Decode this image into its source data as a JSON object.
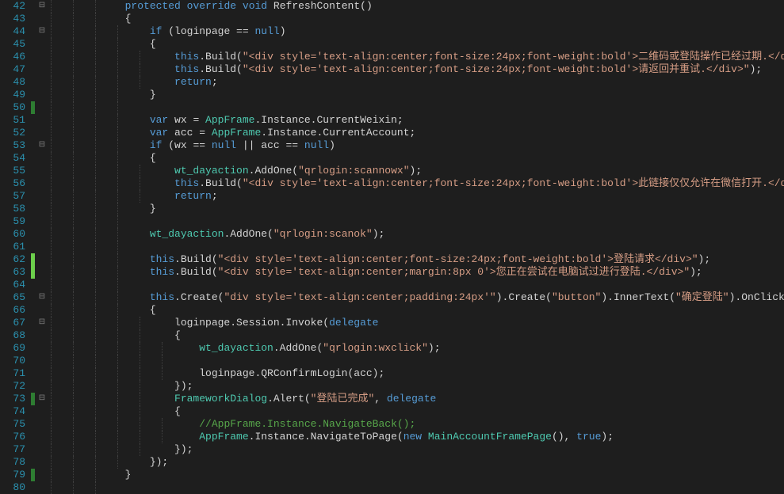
{
  "startLine": 42,
  "lines": [
    {
      "ln": 42,
      "fold": "⊟",
      "mark": "",
      "guides": 3,
      "html": "            <span class='kw'>protected</span> <span class='kw'>override</span> <span class='kw'>void</span> <span class='txt'>RefreshContent()</span>"
    },
    {
      "ln": 43,
      "fold": "",
      "mark": "",
      "guides": 3,
      "html": "            {"
    },
    {
      "ln": 44,
      "fold": "⊟",
      "mark": "",
      "guides": 4,
      "html": "                <span class='kw'>if</span> (loginpage == <span class='kw'>null</span>)"
    },
    {
      "ln": 45,
      "fold": "",
      "mark": "",
      "guides": 4,
      "html": "                {"
    },
    {
      "ln": 46,
      "fold": "",
      "mark": "",
      "guides": 5,
      "html": "                    <span class='kw'>this</span>.Build(<span class='str'>\"&lt;div style='text-align:center;font-size:24px;font-weight:bold'&gt;二维码或登陆操作已经过期.&lt;/div&gt;\"</span>);"
    },
    {
      "ln": 47,
      "fold": "",
      "mark": "",
      "guides": 5,
      "html": "                    <span class='kw'>this</span>.Build(<span class='str'>\"&lt;div style='text-align:center;font-size:24px;font-weight:bold'&gt;请返回并重试.&lt;/div&gt;\"</span>);"
    },
    {
      "ln": 48,
      "fold": "",
      "mark": "",
      "guides": 5,
      "html": "                    <span class='kw'>return</span>;"
    },
    {
      "ln": 49,
      "fold": "",
      "mark": "",
      "guides": 4,
      "html": "                }"
    },
    {
      "ln": 50,
      "fold": "",
      "mark": "green",
      "guides": 4,
      "html": ""
    },
    {
      "ln": 51,
      "fold": "",
      "mark": "",
      "guides": 4,
      "html": "                <span class='kw'>var</span> wx = <span class='type'>AppFrame</span>.Instance.CurrentWeixin;"
    },
    {
      "ln": 52,
      "fold": "",
      "mark": "",
      "guides": 4,
      "html": "                <span class='kw'>var</span> acc = <span class='type'>AppFrame</span>.Instance.CurrentAccount;"
    },
    {
      "ln": 53,
      "fold": "⊟",
      "mark": "",
      "guides": 4,
      "html": "                <span class='kw'>if</span> (wx == <span class='kw'>null</span> || acc == <span class='kw'>null</span>)"
    },
    {
      "ln": 54,
      "fold": "",
      "mark": "",
      "guides": 4,
      "html": "                {"
    },
    {
      "ln": 55,
      "fold": "",
      "mark": "",
      "guides": 5,
      "html": "                    <span class='type'>wt_dayaction</span>.AddOne(<span class='str'>\"qrlogin:scannowx\"</span>);"
    },
    {
      "ln": 56,
      "fold": "",
      "mark": "",
      "guides": 5,
      "html": "                    <span class='kw'>this</span>.Build(<span class='str'>\"&lt;div style='text-align:center;font-size:24px;font-weight:bold'&gt;此链接仅仅允许在微信打开.&lt;/div&gt;\"</span>);"
    },
    {
      "ln": 57,
      "fold": "",
      "mark": "",
      "guides": 5,
      "html": "                    <span class='kw'>return</span>;"
    },
    {
      "ln": 58,
      "fold": "",
      "mark": "",
      "guides": 4,
      "html": "                }"
    },
    {
      "ln": 59,
      "fold": "",
      "mark": "",
      "guides": 4,
      "html": ""
    },
    {
      "ln": 60,
      "fold": "",
      "mark": "",
      "guides": 4,
      "html": "                <span class='type'>wt_dayaction</span>.AddOne(<span class='str'>\"qrlogin:scanok\"</span>);"
    },
    {
      "ln": 61,
      "fold": "",
      "mark": "",
      "guides": 4,
      "html": ""
    },
    {
      "ln": 62,
      "fold": "",
      "mark": "lime",
      "guides": 4,
      "html": "                <span class='kw'>this</span>.Build(<span class='str'>\"&lt;div style='text-align:center;font-size:24px;font-weight:bold'&gt;登陆请求&lt;/div&gt;\"</span>);"
    },
    {
      "ln": 63,
      "fold": "",
      "mark": "lime",
      "guides": 4,
      "html": "                <span class='kw'>this</span>.Build(<span class='str'>\"&lt;div style='text-align:center;margin:8px 0'&gt;您正在尝试在电脑试过进行登陆.&lt;/div&gt;\"</span>);"
    },
    {
      "ln": 64,
      "fold": "",
      "mark": "",
      "guides": 4,
      "html": ""
    },
    {
      "ln": 65,
      "fold": "⊟",
      "mark": "",
      "guides": 4,
      "html": "                <span class='kw'>this</span>.Create(<span class='str'>\"div style='text-align:center;padding:24px'\"</span>).Create(<span class='str'>\"button\"</span>).InnerText(<span class='str'>\"确定登陆\"</span>).OnClick(<span class='kw'>delegate</span>"
    },
    {
      "ln": 66,
      "fold": "",
      "mark": "",
      "guides": 4,
      "html": "                {"
    },
    {
      "ln": 67,
      "fold": "⊟",
      "mark": "",
      "guides": 5,
      "html": "                    loginpage.Session.Invoke(<span class='kw'>delegate</span>"
    },
    {
      "ln": 68,
      "fold": "",
      "mark": "",
      "guides": 5,
      "html": "                    {"
    },
    {
      "ln": 69,
      "fold": "",
      "mark": "",
      "guides": 6,
      "html": "                        <span class='type'>wt_dayaction</span>.AddOne(<span class='str'>\"qrlogin:wxclick\"</span>);"
    },
    {
      "ln": 70,
      "fold": "",
      "mark": "",
      "guides": 6,
      "html": ""
    },
    {
      "ln": 71,
      "fold": "",
      "mark": "",
      "guides": 6,
      "html": "                        loginpage.QRConfirmLogin(acc);"
    },
    {
      "ln": 72,
      "fold": "",
      "mark": "",
      "guides": 5,
      "html": "                    });"
    },
    {
      "ln": 73,
      "fold": "⊟",
      "mark": "green",
      "guides": 5,
      "html": "                    <span class='type'>FrameworkDialog</span>.Alert(<span class='str'>\"登陆已完成\"</span>, <span class='kw'>delegate</span>"
    },
    {
      "ln": 74,
      "fold": "",
      "mark": "",
      "guides": 5,
      "html": "                    {"
    },
    {
      "ln": 75,
      "fold": "",
      "mark": "",
      "guides": 6,
      "html": "                        <span class='cmt'>//AppFrame.Instance.NavigateBack();</span>"
    },
    {
      "ln": 76,
      "fold": "",
      "mark": "",
      "guides": 6,
      "html": "                        <span class='type'>AppFrame</span>.Instance.NavigateToPage(<span class='kw'>new</span> <span class='type'>MainAccountFramePage</span>(), <span class='kw'>true</span>);"
    },
    {
      "ln": 77,
      "fold": "",
      "mark": "",
      "guides": 5,
      "html": "                    });"
    },
    {
      "ln": 78,
      "fold": "",
      "mark": "",
      "guides": 4,
      "html": "                });"
    },
    {
      "ln": 79,
      "fold": "",
      "mark": "green",
      "guides": 3,
      "html": "            }"
    },
    {
      "ln": 80,
      "fold": "",
      "mark": "",
      "guides": 3,
      "html": ""
    }
  ]
}
